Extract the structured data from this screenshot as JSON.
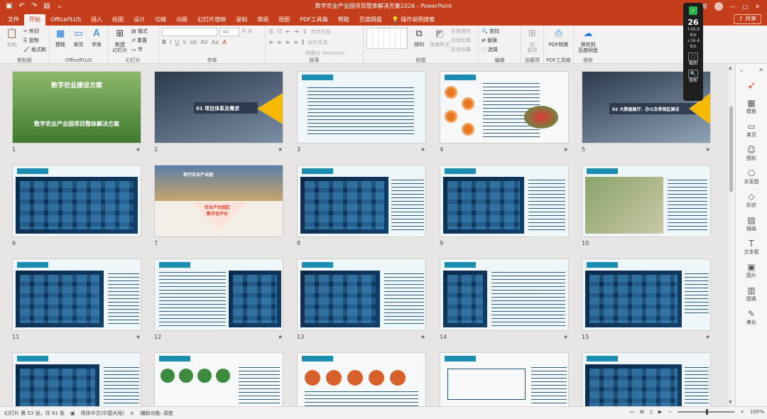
{
  "window": {
    "title": "数字农业产业园项目整体解决方案2026 - PowerPoint",
    "user": "丰利 邦",
    "share_label": "共享"
  },
  "tabs": [
    "文件",
    "开始",
    "OfficePLUS",
    "插入",
    "绘图",
    "设计",
    "切换",
    "动画",
    "幻灯片放映",
    "录制",
    "审阅",
    "视图",
    "PDF工具箱",
    "帮助",
    "百度网盘",
    "操作说明搜索"
  ],
  "active_tab": "开始",
  "ribbon": {
    "clipboard": {
      "label": "剪贴板",
      "paste": "粘贴",
      "cut": "剪切",
      "copy": "复制",
      "format_painter": "格式刷"
    },
    "officeplus": {
      "label": "OfficePLUS",
      "template": "模板",
      "single_page": "单页",
      "font": "字体"
    },
    "slides": {
      "label": "幻灯片",
      "new_slide": "新建\n幻灯片",
      "layout": "版式",
      "reset": "重置",
      "section": "节"
    },
    "font": {
      "label": "字体",
      "size": "44"
    },
    "paragraph": {
      "label": "段落",
      "text_direction": "文字方向",
      "align_text": "对齐文本",
      "smartart": "转换为 SmartArt"
    },
    "drawing": {
      "label": "绘图",
      "arrange": "排列",
      "quick_styles": "快速样式",
      "fill": "形状填充",
      "outline": "形状轮廓",
      "effects": "形状效果"
    },
    "editing": {
      "label": "编辑",
      "find": "查找",
      "replace": "替换",
      "select": "选择"
    },
    "addins": {
      "label": "加载项",
      "btn": "加\n载项"
    },
    "pdf": {
      "label": "PDF工具箱",
      "btn": "PDF转换"
    },
    "save": {
      "label": "保存",
      "btn": "保存到\n百度网盘"
    }
  },
  "slides": [
    {
      "n": "1",
      "title": "数字农业建设方案",
      "subtitle": "数字农业产业园项目整体解决方案"
    },
    {
      "n": "2",
      "title": "01 项目体系及需求"
    },
    {
      "n": "3",
      "title": ""
    },
    {
      "n": "4",
      "title": ""
    },
    {
      "n": "5",
      "title": "02 大数据展厅、办公及参观区建设"
    },
    {
      "n": "6",
      "title": ""
    },
    {
      "n": "7",
      "title": "现代农业产业园",
      "subtitle": "农业产业园区\n数字化平台"
    },
    {
      "n": "8",
      "title": ""
    },
    {
      "n": "9",
      "title": ""
    },
    {
      "n": "10",
      "title": ""
    },
    {
      "n": "11",
      "title": ""
    },
    {
      "n": "12",
      "title": ""
    },
    {
      "n": "13",
      "title": ""
    },
    {
      "n": "14",
      "title": ""
    },
    {
      "n": "15",
      "title": ""
    },
    {
      "n": "",
      "title": ""
    },
    {
      "n": "",
      "title": ""
    },
    {
      "n": "",
      "title": ""
    },
    {
      "n": "",
      "title": ""
    },
    {
      "n": "",
      "title": ""
    }
  ],
  "right_panel": {
    "items": [
      "模板",
      "单页",
      "图标",
      "关系图",
      "形状",
      "插画",
      "文本框",
      "图片",
      "图表",
      "美化"
    ]
  },
  "widget": {
    "value": "26",
    "up": "43.6",
    "up_unit": "K/s",
    "down": "16.4",
    "down_unit": "K/s",
    "btn1": "截图",
    "btn2": "搜索"
  },
  "status": {
    "slide_count": "幻灯片 第 53 张，共 91 张",
    "language": "简体中文(中国大陆)",
    "accessibility": "辅助功能: 调查",
    "zoom": "100%"
  }
}
